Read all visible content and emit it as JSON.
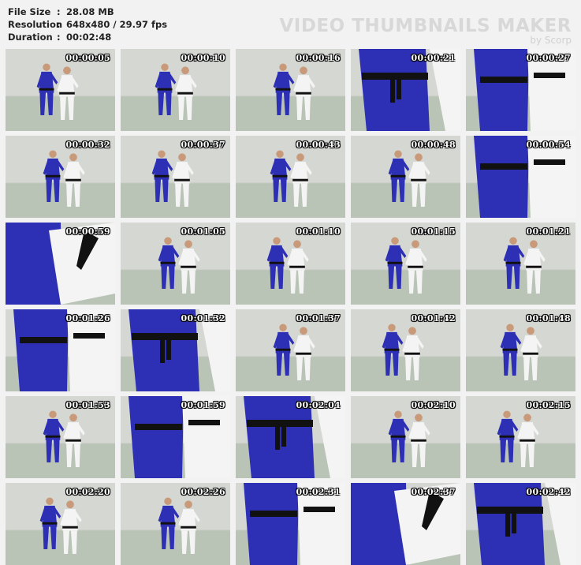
{
  "info": {
    "file_size_label": "File Size",
    "file_size_value": "28.08 MB",
    "resolution_label": "Resolution",
    "resolution_value": "648x480 / 29.97 fps",
    "duration_label": "Duration",
    "duration_value": "00:02:48",
    "separator": ":"
  },
  "watermark": {
    "title": "VIDEO THUMBNAILS MAKER",
    "subtitle": "by Scorp"
  },
  "colors": {
    "background": "#f2f2f2",
    "floor": "#b9c4b6",
    "wall": "#d5d7d2",
    "blue_gi": "#2d2fb4",
    "white_gi": "#f4f4f4",
    "black_belt": "#111111"
  },
  "thumbnails": [
    {
      "time": "00:00:05",
      "scene": "wide"
    },
    {
      "time": "00:00:10",
      "scene": "wide"
    },
    {
      "time": "00:00:16",
      "scene": "wide"
    },
    {
      "time": "00:00:21",
      "scene": "closeblue"
    },
    {
      "time": "00:00:27",
      "scene": "closemix"
    },
    {
      "time": "00:00:32",
      "scene": "wide"
    },
    {
      "time": "00:00:37",
      "scene": "wide"
    },
    {
      "time": "00:00:43",
      "scene": "wide"
    },
    {
      "time": "00:00:48",
      "scene": "wide"
    },
    {
      "time": "00:00:54",
      "scene": "closemix"
    },
    {
      "time": "00:00:59",
      "scene": "closewhite"
    },
    {
      "time": "00:01:05",
      "scene": "wide"
    },
    {
      "time": "00:01:10",
      "scene": "wide"
    },
    {
      "time": "00:01:15",
      "scene": "wide"
    },
    {
      "time": "00:01:21",
      "scene": "wide"
    },
    {
      "time": "00:01:26",
      "scene": "closemix"
    },
    {
      "time": "00:01:32",
      "scene": "closeblue"
    },
    {
      "time": "00:01:37",
      "scene": "wide"
    },
    {
      "time": "00:01:42",
      "scene": "wide"
    },
    {
      "time": "00:01:48",
      "scene": "wide"
    },
    {
      "time": "00:01:53",
      "scene": "wide"
    },
    {
      "time": "00:01:59",
      "scene": "closemix"
    },
    {
      "time": "00:02:04",
      "scene": "closeblue"
    },
    {
      "time": "00:02:10",
      "scene": "wide"
    },
    {
      "time": "00:02:15",
      "scene": "wide"
    },
    {
      "time": "00:02:20",
      "scene": "wide"
    },
    {
      "time": "00:02:26",
      "scene": "wide"
    },
    {
      "time": "00:02:31",
      "scene": "closemix"
    },
    {
      "time": "00:02:37",
      "scene": "closewhite"
    },
    {
      "time": "00:02:42",
      "scene": "closeblue"
    }
  ]
}
